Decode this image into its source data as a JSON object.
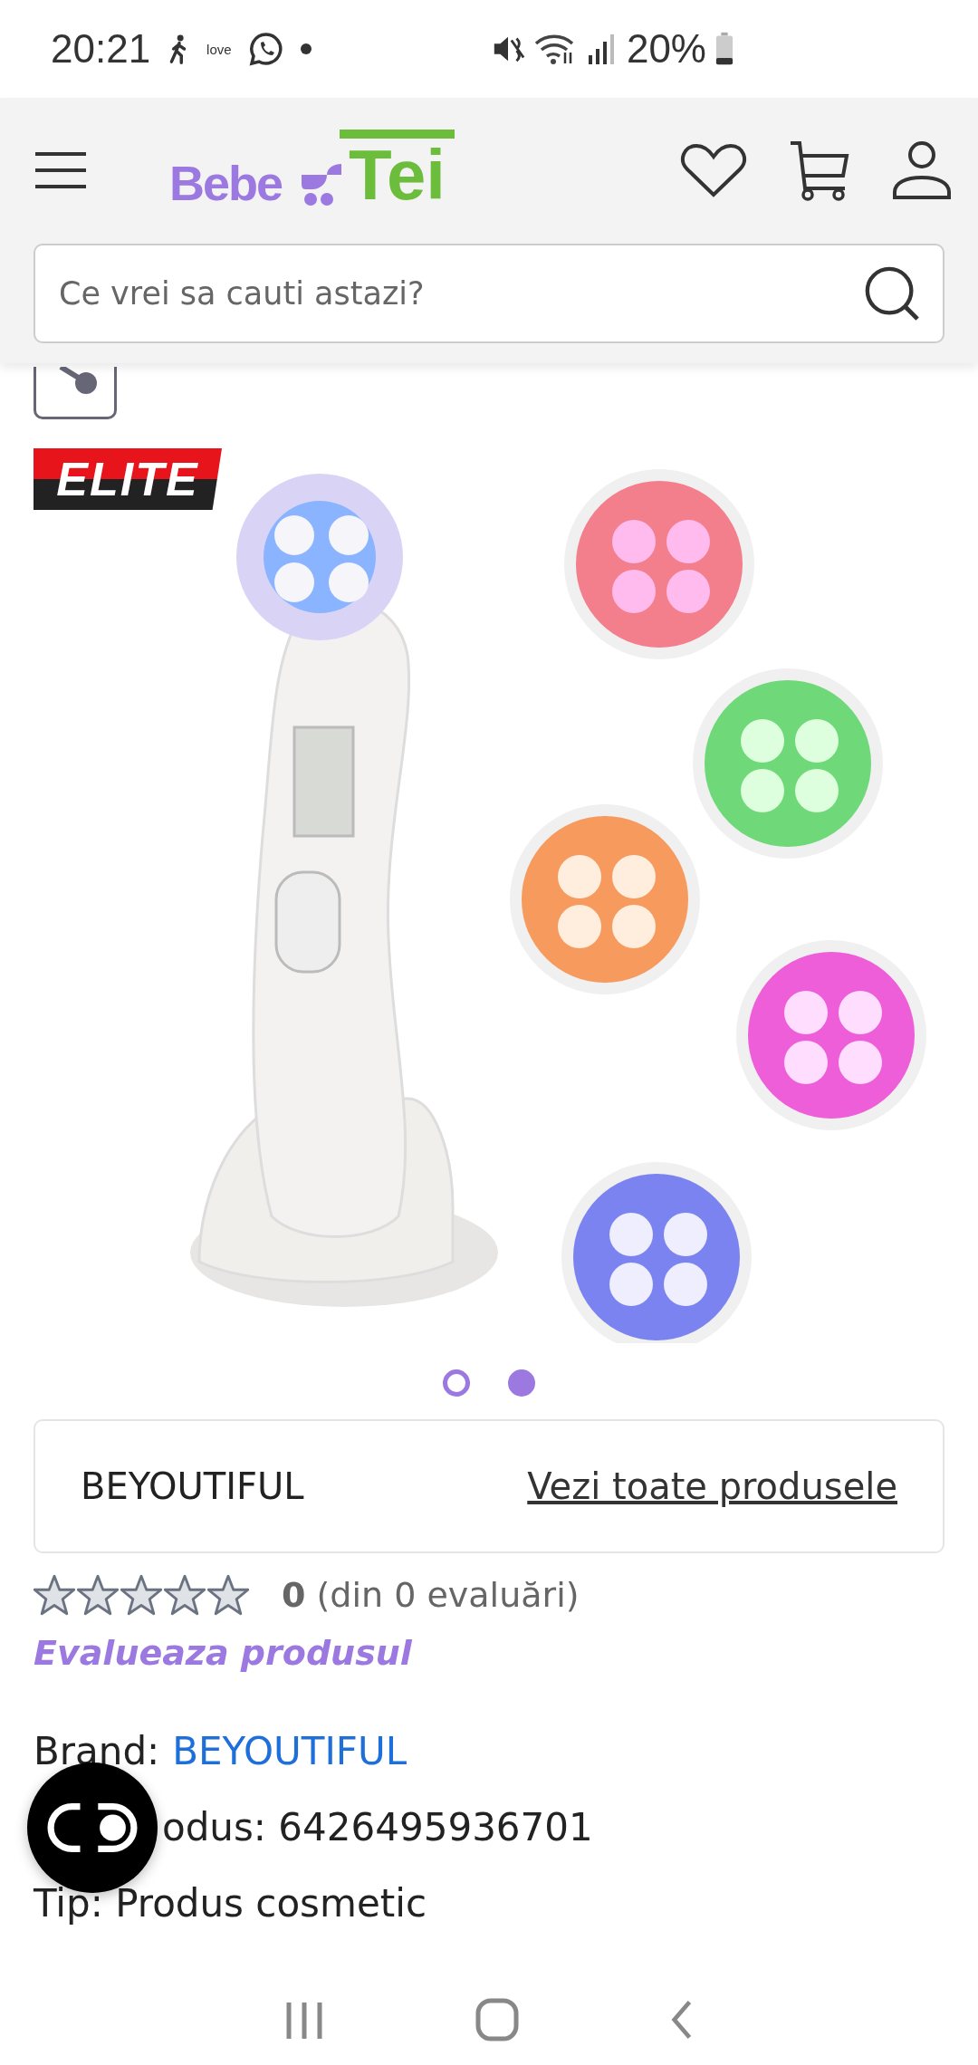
{
  "status_bar": {
    "time": "20:21",
    "notification_text": "love",
    "battery": "20%"
  },
  "header": {
    "logo": {
      "first": "Bebe",
      "second": "Tei"
    },
    "search": {
      "placeholder": "Ce vrei sa cauti astazi?"
    }
  },
  "gallery": {
    "badge": "ELITE",
    "dots": [
      {
        "selected": false
      },
      {
        "selected": true
      }
    ]
  },
  "brand_card": {
    "name": "BEYOUTIFUL",
    "link": "Vezi toate produsele"
  },
  "rating": {
    "stars": 0,
    "score": "0",
    "count": "(din 0 evaluări)",
    "rate_link": "Evalueaza produsul"
  },
  "details": [
    {
      "kind": "link",
      "label": "Brand:",
      "value": "BEYOUTIFUL"
    },
    {
      "kind": "text",
      "text": "odus: 6426495936701"
    },
    {
      "kind": "text",
      "text": "Tip: Produs cosmetic"
    }
  ]
}
